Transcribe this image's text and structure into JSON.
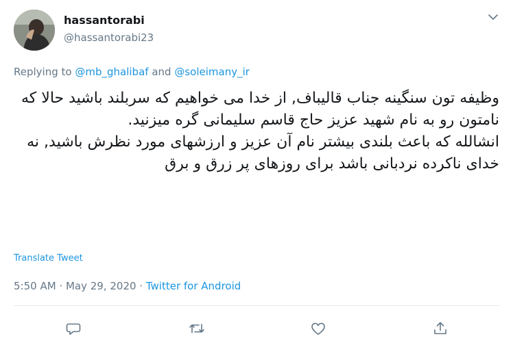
{
  "user": {
    "display_name": "hassantorabi",
    "handle": "@hassantorabi23",
    "avatar_icon": "avatar-photo"
  },
  "reply": {
    "prefix": "Replying to",
    "mention_1": "@mb_ghalibaf",
    "conjunction": "and",
    "mention_2": "@soleimany_ir"
  },
  "tweet": {
    "paragraph_1": "وظیفه تون سنگینه جناب قالیباف, از خدا می خواهیم که سربلند باشید حالا که نامتون رو به نام شهید عزیز حاج قاسم سلیمانی گره میزنید.",
    "paragraph_2": "انشالله که باعث بلندی بیشتر نام آن عزیز و ارزشهای مورد نظرش باشید, نه خدای ناکرده نردبانی باشد برای روزهای پر زرق و برق"
  },
  "translate_label": "Translate Tweet",
  "meta": {
    "time": "5:50 AM",
    "separator": " · ",
    "date": "May 29, 2020",
    "source": "Twitter for Android"
  },
  "actions": [
    "reply-icon",
    "retweet-icon",
    "like-icon",
    "share-icon"
  ],
  "colors": {
    "link": "#1b95e0",
    "secondary": "#657786",
    "divider": "#e6ecf0"
  }
}
